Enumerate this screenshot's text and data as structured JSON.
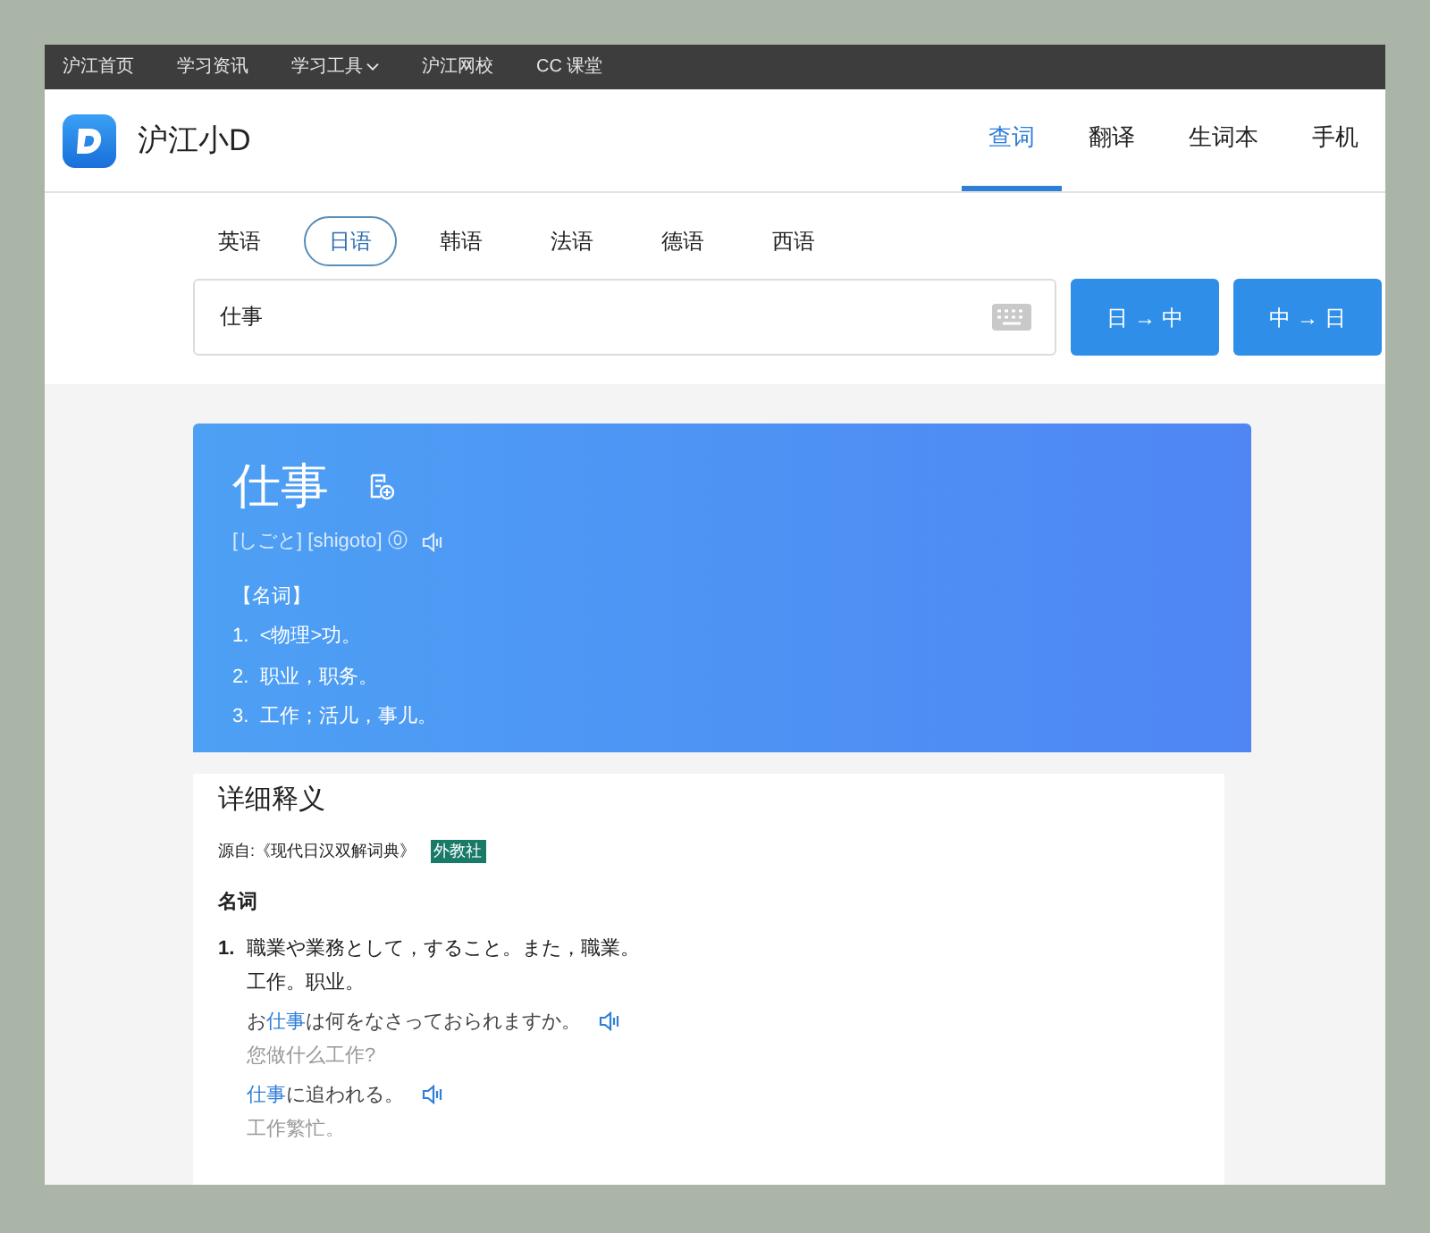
{
  "top_nav": [
    {
      "label": "沪江首页",
      "dropdown": false
    },
    {
      "label": "学习资讯",
      "dropdown": false
    },
    {
      "label": "学习工具",
      "dropdown": true
    },
    {
      "label": "沪江网校",
      "dropdown": false
    },
    {
      "label": "CC 课堂",
      "dropdown": false
    }
  ],
  "brand": "沪江小D",
  "main_tabs": [
    {
      "label": "查词",
      "selected": true
    },
    {
      "label": "翻译",
      "selected": false
    },
    {
      "label": "生词本",
      "selected": false
    },
    {
      "label": "手机",
      "selected": false
    }
  ],
  "languages": [
    {
      "label": "英语",
      "selected": false
    },
    {
      "label": "日语",
      "selected": true
    },
    {
      "label": "韩语",
      "selected": false
    },
    {
      "label": "法语",
      "selected": false
    },
    {
      "label": "德语",
      "selected": false
    },
    {
      "label": "西语",
      "selected": false
    }
  ],
  "search": {
    "value": "仕事"
  },
  "search_buttons": [
    "日 → 中",
    "中 → 日"
  ],
  "word_card": {
    "word": "仕事",
    "pronunciation": "[しごと] [shigoto] ⓪",
    "pos": "【名词】",
    "meanings": [
      {
        "number": "1.",
        "text": "<物理>功。"
      },
      {
        "number": "2.",
        "text": "职业，职务。"
      },
      {
        "number": "3.",
        "text": "工作；活儿，事儿。"
      }
    ]
  },
  "detail": {
    "title": "详细释义",
    "source": "源自:《现代日汉双解词典》",
    "publisher": "外教社",
    "pos": "名词",
    "entries": [
      {
        "number": "1.",
        "definition": "職業や業務として，すること。また，職業。",
        "translation": "工作。职业。",
        "examples": [
          {
            "sentence": [
              {
                "text": "お",
                "highlight": false
              },
              {
                "text": "仕事",
                "highlight": true
              },
              {
                "text": "は何をなさっておられますか。",
                "highlight": false
              }
            ],
            "translation": "您做什么工作?"
          },
          {
            "sentence": [
              {
                "text": "仕事",
                "highlight": true
              },
              {
                "text": "に追われる。",
                "highlight": false
              }
            ],
            "translation": "工作繁忙。"
          }
        ]
      }
    ]
  }
}
